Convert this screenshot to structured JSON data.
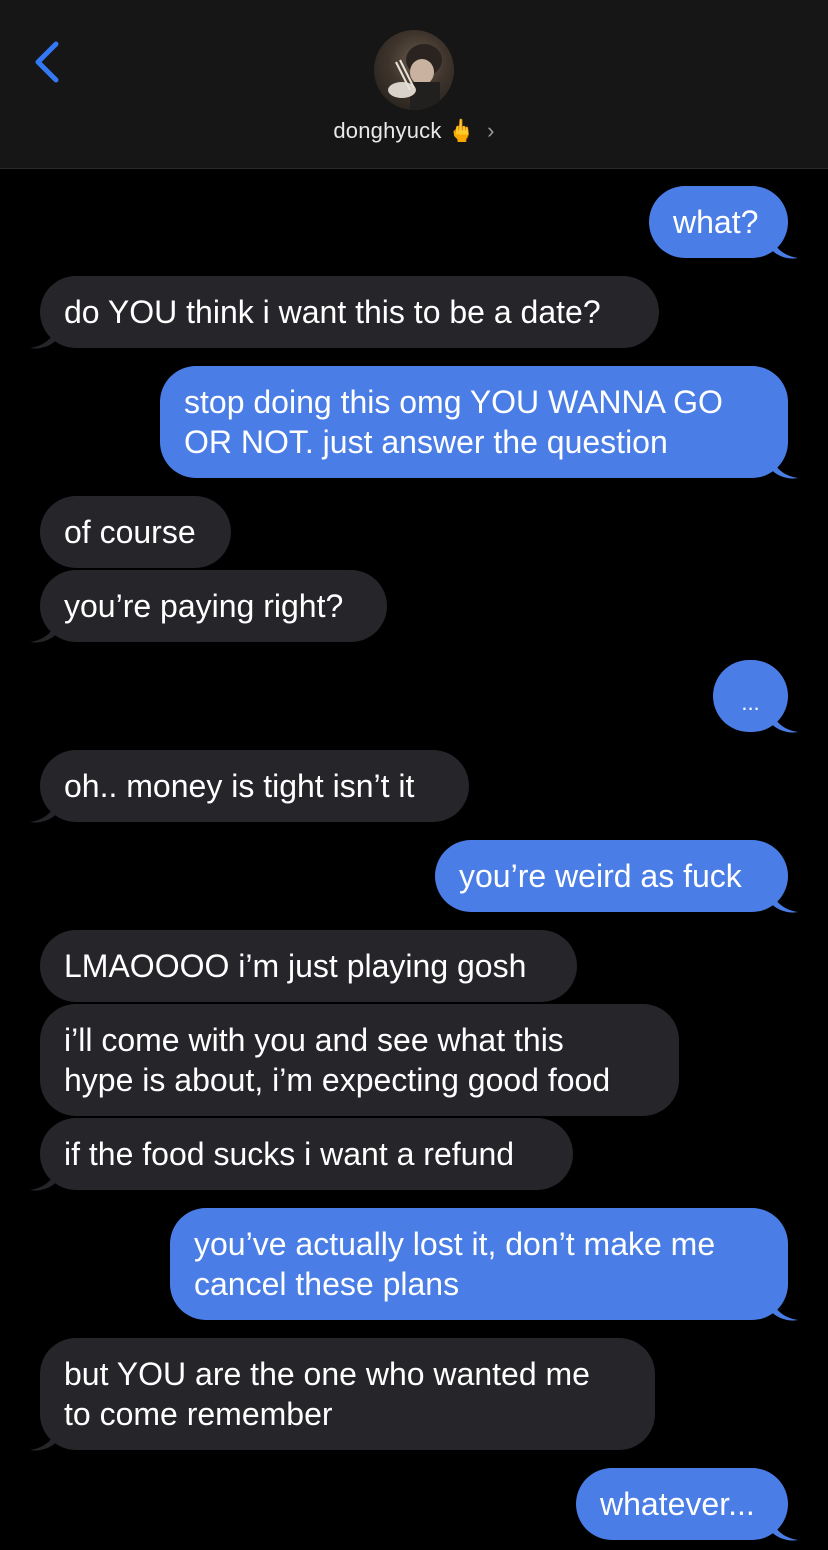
{
  "header": {
    "contact_name": "donghyuck",
    "contact_emoji": "🖕",
    "icons": [
      "back-chevron-icon",
      "contact-chevron-icon"
    ]
  },
  "colors": {
    "outgoing": "#4a7ee6",
    "incoming": "#26252a",
    "accent": "#3478f6"
  },
  "messages": [
    {
      "from": "me",
      "text": "what?"
    },
    {
      "from": "them",
      "text": "do YOU think i want this to be a date?"
    },
    {
      "from": "me",
      "text": "stop doing this omg YOU WANNA GO\nOR NOT. just answer the question"
    },
    {
      "from": "them",
      "text": "of course"
    },
    {
      "from": "them",
      "text": "you’re paying right?"
    },
    {
      "from": "me",
      "text": "..."
    },
    {
      "from": "them",
      "text": "oh.. money is tight isn’t it"
    },
    {
      "from": "me",
      "text": "you’re weird as fuck"
    },
    {
      "from": "them",
      "text": "LMAOOOO i’m just playing gosh"
    },
    {
      "from": "them",
      "text": "i’ll come with you and see what this\nhype is about, i’m expecting good food"
    },
    {
      "from": "them",
      "text": "if the food sucks i want a refund"
    },
    {
      "from": "me",
      "text": "you’ve actually lost it, don’t make me\ncancel these plans"
    },
    {
      "from": "them",
      "text": "but YOU are the one who wanted me\nto come remember"
    },
    {
      "from": "me",
      "text": "whatever..."
    }
  ]
}
